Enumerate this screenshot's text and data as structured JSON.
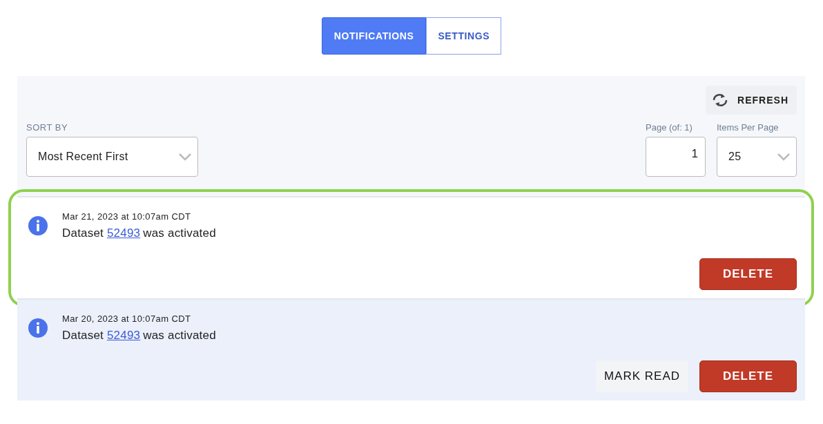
{
  "tabs": [
    {
      "label": "NOTIFICATIONS",
      "selected": true
    },
    {
      "label": "SETTINGS",
      "selected": false
    }
  ],
  "toolbar": {
    "refresh": "REFRESH",
    "sort_label": "SORT BY",
    "sort_value": "Most Recent First",
    "page_label": "Page (of: 1)",
    "page_value": "1",
    "per_page_label": "Items Per Page",
    "per_page_value": "25"
  },
  "notifications": [
    {
      "timestamp": "Mar 21, 2023 at 10:07am CDT",
      "text_before": "Dataset",
      "link": "52493",
      "text_after": "was activated",
      "unread": false,
      "highlighted": true,
      "delete": "DELETE"
    },
    {
      "timestamp": "Mar 20, 2023 at 10:07am CDT",
      "text_before": "Dataset",
      "link": "52493",
      "text_after": "was activated",
      "unread": true,
      "highlighted": false,
      "mark_read": "MARK READ",
      "delete": "DELETE"
    }
  ]
}
